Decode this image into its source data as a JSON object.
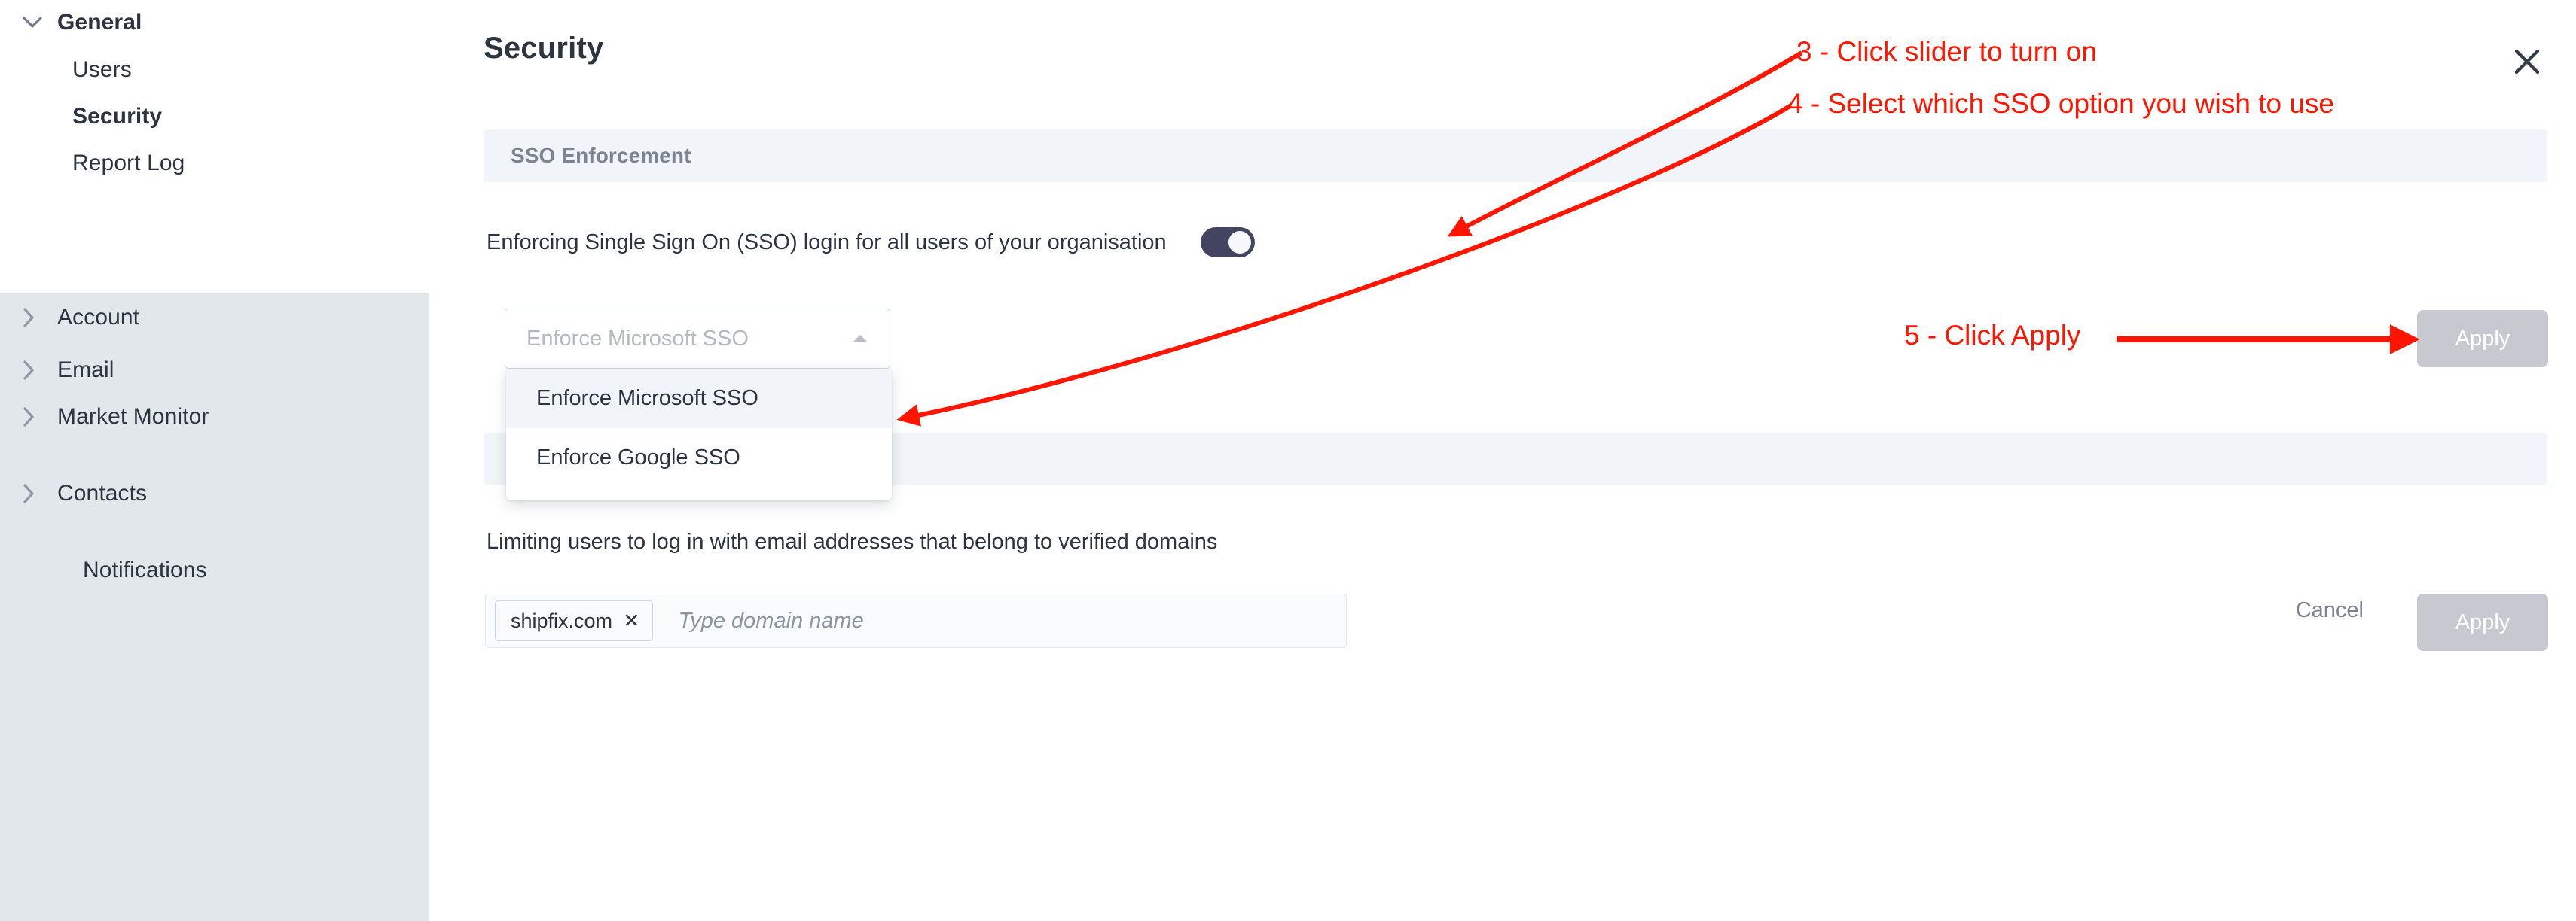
{
  "sidebar": {
    "items": [
      {
        "label": "General",
        "icon": "chevron-down-icon",
        "level": "top",
        "bold": true,
        "expanded": true
      },
      {
        "label": "Users",
        "icon": "none",
        "level": "sub",
        "bold": false
      },
      {
        "label": "Security",
        "icon": "none",
        "level": "sub",
        "bold": true,
        "selected": true
      },
      {
        "label": "Report Log",
        "icon": "none",
        "level": "sub",
        "bold": false
      },
      {
        "label": "Account",
        "icon": "chevron-right-icon",
        "level": "top",
        "bold": false
      },
      {
        "label": "Email",
        "icon": "chevron-right-icon",
        "level": "top",
        "bold": false
      },
      {
        "label": "Market Monitor",
        "icon": "chevron-right-icon",
        "level": "top",
        "bold": false
      },
      {
        "label": "Contacts",
        "icon": "chevron-right-icon",
        "level": "top",
        "bold": false
      },
      {
        "label": "Notifications",
        "icon": "none",
        "level": "top",
        "bold": false
      }
    ]
  },
  "header": {
    "title": "Security",
    "close_icon": "close-icon"
  },
  "sso_section": {
    "band_title": "SSO Enforcement",
    "toggle_label": "Enforcing Single Sign On (SSO) login for all users of your organisation",
    "toggle_state": "on",
    "select": {
      "value": "Enforce Microsoft SSO",
      "caret_icon": "chevron-up-icon",
      "open": true,
      "options": [
        "Enforce Microsoft SSO",
        "Enforce Google SSO"
      ],
      "highlighted_option": "Enforce Microsoft SSO"
    },
    "apply_label": "Apply"
  },
  "domains_section": {
    "band_title": "",
    "description": "Limiting users to log in with email addresses that belong to verified domains",
    "chips": [
      {
        "label": "shipfix.com",
        "remove_icon": "close-icon"
      }
    ],
    "input_placeholder": "Type domain name",
    "input_value": "",
    "cancel_label": "Cancel",
    "apply_label": "Apply"
  },
  "annotations": {
    "color": "#ff1500",
    "steps": [
      {
        "id": "step3",
        "text": "3 - Click slider to turn on"
      },
      {
        "id": "step4",
        "text": "4 - Select which SSO option you wish to use"
      },
      {
        "id": "step5",
        "text": "5 - Click Apply"
      }
    ]
  },
  "colors": {
    "sidebar_bg": "#e2e7eb",
    "band_bg": "#f1f4f8",
    "toggle_on": "#434362",
    "button_disabled": "#c8c9d0",
    "text_primary": "#2c3440",
    "annotation_red": "#ff1500"
  }
}
